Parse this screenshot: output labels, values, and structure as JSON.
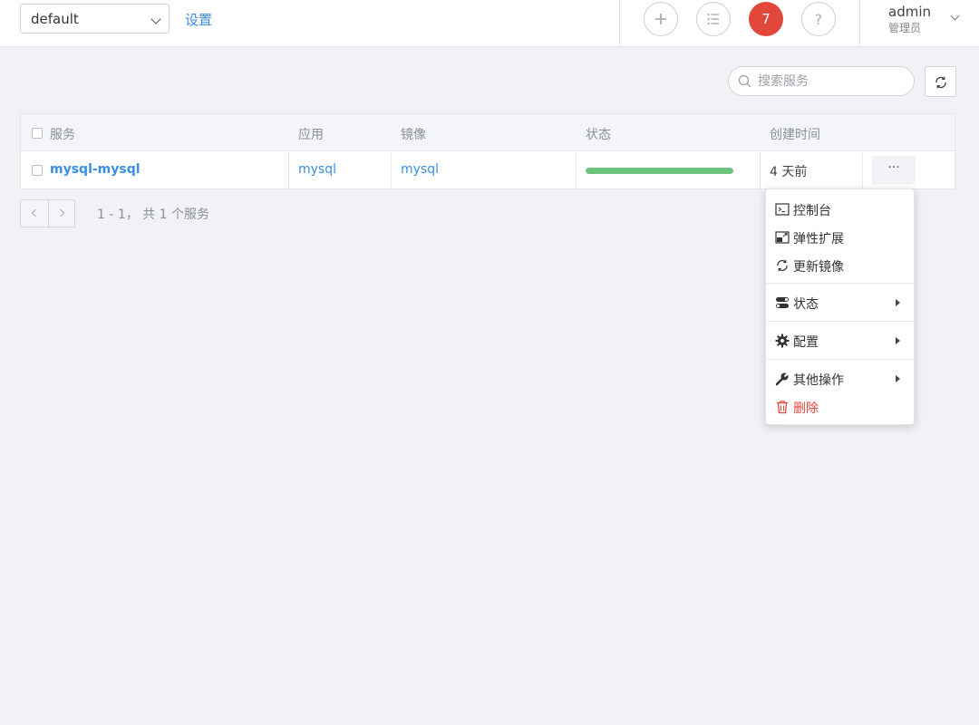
{
  "header": {
    "namespace_value": "default",
    "settings_label": "设置",
    "notification_count": "7",
    "user_name": "admin",
    "user_role": "管理员"
  },
  "toolbar": {
    "search_placeholder": "搜索服务"
  },
  "table": {
    "columns": [
      "服务",
      "应用",
      "镜像",
      "状态",
      "创建时间"
    ],
    "rows": [
      {
        "service": "mysql-mysql",
        "app": "mysql",
        "image": "mysql",
        "status_progress": 1.0,
        "created": "4 天前",
        "more_label": "···"
      }
    ]
  },
  "pagination": {
    "summary": "1 - 1， 共 1 个服务"
  },
  "context_menu": {
    "items": [
      {
        "label": "控制台",
        "icon": "terminal-icon",
        "submenu": false
      },
      {
        "label": "弹性扩展",
        "icon": "scale-icon",
        "submenu": false
      },
      {
        "label": "更新镜像",
        "icon": "refresh-icon",
        "submenu": false
      },
      {
        "label": "状态",
        "icon": "toggle-icon",
        "submenu": true
      },
      {
        "label": "配置",
        "icon": "gear-icon",
        "submenu": true
      },
      {
        "label": "其他操作",
        "icon": "wrench-icon",
        "submenu": true
      },
      {
        "label": "删除",
        "icon": "trash-icon",
        "submenu": false
      }
    ]
  },
  "colors": {
    "link": "#3b8ee2",
    "badge": "#e1483b",
    "progress": "#6bc27c",
    "danger": "#e1483b"
  }
}
